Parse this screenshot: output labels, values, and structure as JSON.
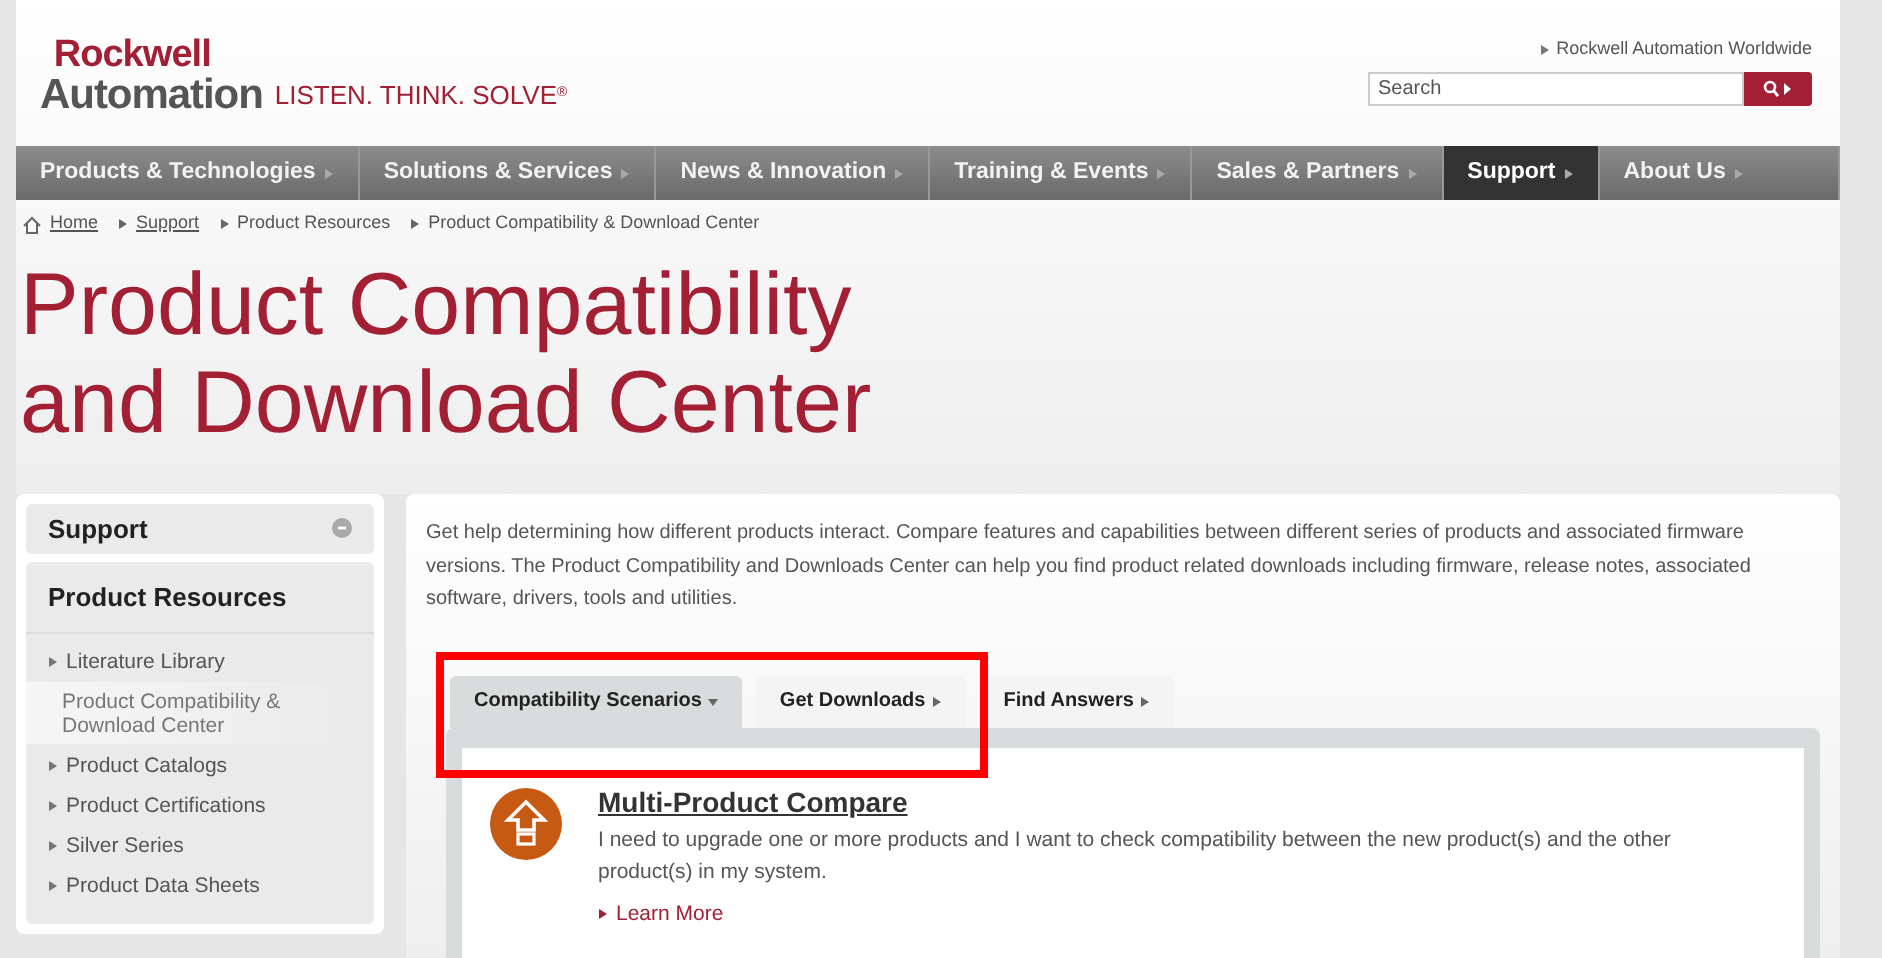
{
  "header": {
    "brand_top": "Rockwell",
    "brand_bottom": "Automation",
    "tagline": "LISTEN. THINK. SOLVE",
    "tagline_mark": "®",
    "worldwide_link": "Rockwell Automation Worldwide",
    "search": {
      "placeholder": "Search"
    }
  },
  "nav": [
    {
      "label": "Products & Technologies",
      "selected": false
    },
    {
      "label": "Solutions & Services",
      "selected": false
    },
    {
      "label": "News & Innovation",
      "selected": false
    },
    {
      "label": "Training & Events",
      "selected": false
    },
    {
      "label": "Sales & Partners",
      "selected": false
    },
    {
      "label": "Support",
      "selected": true
    },
    {
      "label": "About Us",
      "selected": false
    }
  ],
  "breadcrumb": [
    {
      "label": "Home",
      "link": true
    },
    {
      "label": "Support",
      "link": true
    },
    {
      "label": "Product Resources",
      "link": false
    },
    {
      "label": "Product Compatibility & Download Center",
      "link": false
    }
  ],
  "page_title": [
    "Product Compatibility",
    "and Download Center"
  ],
  "sidebar": {
    "section": "Support",
    "group": "Product Resources",
    "items": [
      {
        "label": "Literature Library",
        "selected": false
      },
      {
        "label": "Product Compatibility & Download Center",
        "selected": true
      },
      {
        "label": "Product Catalogs",
        "selected": false
      },
      {
        "label": "Product Certifications",
        "selected": false
      },
      {
        "label": "Silver Series",
        "selected": false
      },
      {
        "label": "Product Data Sheets",
        "selected": false
      }
    ]
  },
  "intro": "Get help determining how different products interact. Compare features and capabilities between different series of products and associated firmware versions. The Product Compatibility and Downloads Center can help you find product related downloads including firmware, release notes, associated software, drivers, tools and utilities.",
  "tabs": [
    {
      "label": "Compatibility Scenarios",
      "selected": true
    },
    {
      "label": "Get Downloads",
      "selected": false
    },
    {
      "label": "Find Answers",
      "selected": false
    }
  ],
  "scenario": {
    "title": "Multi-Product Compare",
    "description": "I need to upgrade one or more products and I want to check compatibility between the new product(s) and the other product(s) in my system.",
    "link": "Learn More"
  }
}
